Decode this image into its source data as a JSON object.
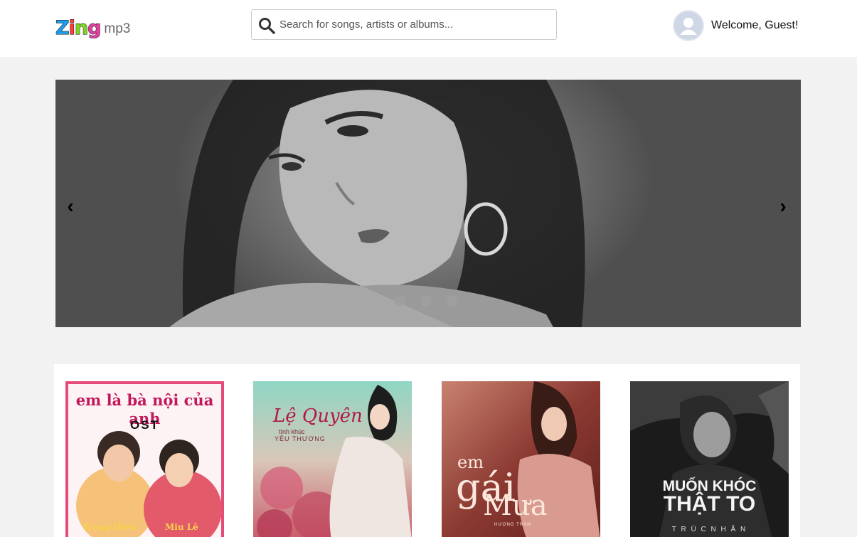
{
  "header": {
    "logo": {
      "brand": "Zing",
      "suffix": "mp3"
    },
    "search": {
      "placeholder": "Search for songs, artists or albums..."
    },
    "user": {
      "welcome": "Welcome, Guest!"
    }
  },
  "slider": {
    "prev_label": "‹",
    "next_label": "›",
    "dots_count": 3
  },
  "albums": [
    {
      "title_line1": "em là bà nội của anh",
      "subtitle": "OST",
      "artist_left": "Trọng Hiếu",
      "artist_right": "Miu Lê"
    },
    {
      "title": "Lệ Quyên",
      "subtitle1": "tình khúc",
      "subtitle2": "YÊU THƯƠNG"
    },
    {
      "title_small": "em",
      "title_big1": "gái",
      "title_big2": "Mưa",
      "artist": "HƯƠNG TRÀM"
    },
    {
      "title1": "MUỐN KHÓC",
      "title2": "THẬT TO",
      "artist": "T R Ú C N H Â N"
    }
  ],
  "colors": {
    "header_bg": "#ffffff",
    "page_bg": "#f2f2f2",
    "logo_z": "#1e9be9",
    "logo_i": "#ff3a3a",
    "logo_n": "#7ed321",
    "logo_g": "#e040a0"
  }
}
